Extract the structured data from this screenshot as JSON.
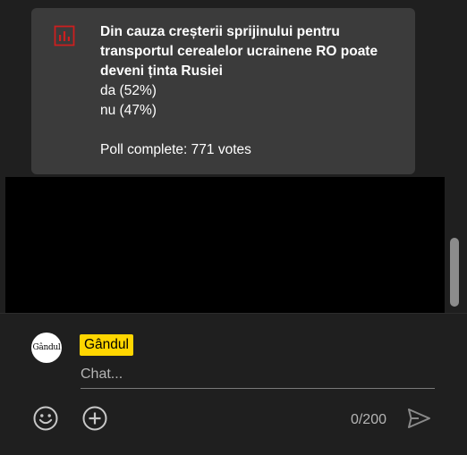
{
  "poll": {
    "icon": "poll-chart-icon",
    "question": "Din cauza creșterii sprijinului pentru transportul cerealelor ucrainene RO poate deveni ținta Rusiei",
    "options": [
      {
        "label": "da (52%)"
      },
      {
        "label": "nu (47%)"
      }
    ],
    "status": "Poll complete: 771 votes",
    "accent_color": "#cc1f1f"
  },
  "chat": {
    "author_avatar_text": "Gândul",
    "author_name": "Gândul",
    "author_chip_color": "#ffd600",
    "input_placeholder": "Chat...",
    "char_count": "0/200",
    "emoji_icon": "emoji-smile-icon",
    "plus_icon": "plus-circle-icon",
    "send_icon": "send-icon"
  }
}
